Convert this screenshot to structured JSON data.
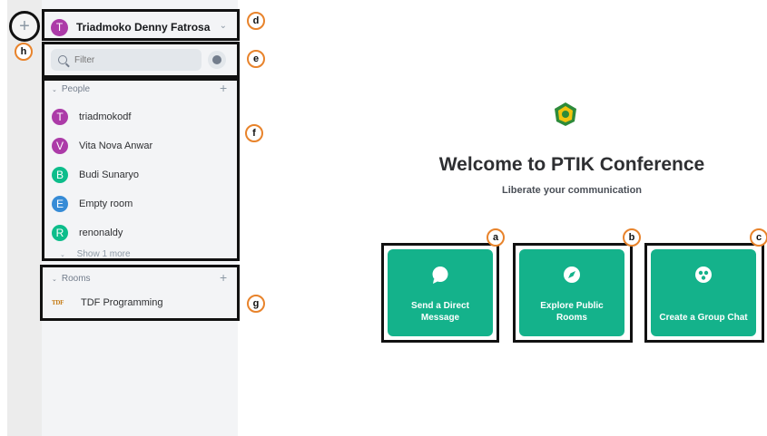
{
  "space_panel": {
    "add_icon": "plus-icon",
    "add_glyph": "+"
  },
  "user_menu": {
    "avatar_initial": "T",
    "avatar_color": "#ac3ba8",
    "name": "Triadmoko Denny Fatrosa",
    "chevron": "⌄"
  },
  "search": {
    "placeholder": "Filter",
    "explore_icon": "compass-icon"
  },
  "people": {
    "header": "People",
    "collapse_glyph": "⌄",
    "add_glyph": "+",
    "items": [
      {
        "initial": "T",
        "name": "triadmokodf",
        "color": "#ac3ba8"
      },
      {
        "initial": "V",
        "name": "Vita Nova Anwar",
        "color": "#ac3ba8"
      },
      {
        "initial": "B",
        "name": "Budi Sunaryo",
        "color": "#0dbd8b"
      },
      {
        "initial": "E",
        "name": "Empty room",
        "color": "#368bd6"
      },
      {
        "initial": "R",
        "name": "renonaldy",
        "color": "#0dbd8b"
      }
    ],
    "show_more": "Show 1 more"
  },
  "rooms": {
    "header": "Rooms",
    "collapse_glyph": "⌄",
    "add_glyph": "+",
    "items": [
      {
        "logo_text": "TDF",
        "name": "TDF Programming"
      }
    ]
  },
  "main": {
    "title": "Welcome to PTIK Conference",
    "tagline": "Liberate your communication",
    "actions": [
      {
        "label": "Send a Direct Message",
        "icon": "chat-bubble-icon"
      },
      {
        "label": "Explore Public Rooms",
        "icon": "compass-icon"
      },
      {
        "label": "Create a Group Chat",
        "icon": "group-icon"
      }
    ]
  },
  "callouts": {
    "a": "a",
    "b": "b",
    "c": "c",
    "d": "d",
    "e": "e",
    "f": "f",
    "g": "g",
    "h": "h"
  },
  "colors": {
    "accent": "#14b28b",
    "callout": "#e8832b"
  }
}
